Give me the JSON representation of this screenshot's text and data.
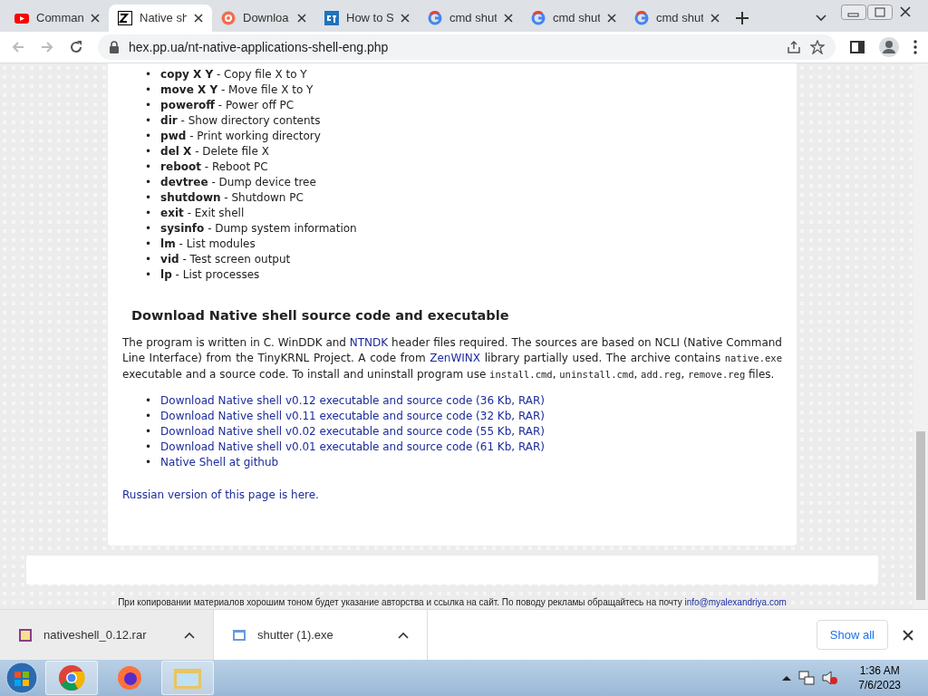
{
  "browser": {
    "tabs": [
      {
        "title": "Comman",
        "selected": false
      },
      {
        "title": "Native sh",
        "selected": true
      },
      {
        "title": "Downloa",
        "selected": false
      },
      {
        "title": "How to S",
        "selected": false
      },
      {
        "title": "cmd shut",
        "selected": false
      },
      {
        "title": "cmd shut",
        "selected": false
      },
      {
        "title": "cmd shut",
        "selected": false
      }
    ],
    "url": "hex.pp.ua/nt-native-applications-shell-eng.php"
  },
  "commands": [
    {
      "bullet": "•",
      "text": "**copy X Y** - Copy file X to Y"
    },
    {
      "bullet": "•",
      "text": "**move X Y** - Move file X to Y"
    },
    {
      "bullet": "•",
      "text": "**poweroff** - Power off PC"
    },
    {
      "bullet": "•",
      "text": "**dir** - Show directory contents"
    },
    {
      "bullet": "•",
      "text": "**pwd** - Print working directory"
    },
    {
      "bullet": "•",
      "text": "**del X** - Delete file X"
    },
    {
      "bullet": "•",
      "text": "**reboot** - Reboot PC"
    },
    {
      "bullet": "•",
      "text": "**devtree** - Dump device tree"
    },
    {
      "bullet": "•",
      "text": "**shutdown** - Shutdown PC"
    },
    {
      "bullet": "•",
      "text": "**exit** - Exit shell"
    },
    {
      "bullet": "•",
      "text": "**sysinfo** - Dump system information"
    },
    {
      "bullet": "•",
      "text": "**lm** - List modules"
    },
    {
      "bullet": "•",
      "text": "**vid** - Test screen output"
    },
    {
      "bullet": "•",
      "text": "**lp** - List processes"
    }
  ],
  "section_title": "Download Native shell source code and executable",
  "paragraph": [
    {
      "kind": "text",
      "text": "The program is written in C. WinDDK and "
    },
    {
      "kind": "link",
      "text": "NTNDK"
    },
    {
      "kind": "text",
      "text": " header files required. The sources are based on NCLI (Native Command Line Interface) from the TinyKRNL Project. A code from "
    },
    {
      "kind": "link",
      "text": "ZenWINX"
    },
    {
      "kind": "text",
      "text": " library partially used. The archive contains "
    },
    {
      "kind": "code",
      "text": "native.exe"
    },
    {
      "kind": "text",
      "text": " executable and a source code. To install and uninstall program use "
    },
    {
      "kind": "code",
      "text": "install.cmd"
    },
    {
      "kind": "text",
      "text": ", "
    },
    {
      "kind": "code",
      "text": "uninstall.cmd"
    },
    {
      "kind": "text",
      "text": ", "
    },
    {
      "kind": "code",
      "text": "add.reg"
    },
    {
      "kind": "text",
      "text": ", "
    },
    {
      "kind": "code",
      "text": "remove.reg"
    },
    {
      "kind": "text",
      "text": " files."
    }
  ],
  "downloads": [
    {
      "bullet": "•",
      "text": "Download Native shell v0.12 executable and source code (36 Kb, RAR)"
    },
    {
      "bullet": "•",
      "text": "Download Native shell v0.11 executable and source code (32 Kb, RAR)"
    },
    {
      "bullet": "•",
      "text": "Download Native shell v0.02 executable and source code (55 Kb, RAR)"
    },
    {
      "bullet": "•",
      "text": "Download Native shell v0.01 executable and source code (61 Kb, RAR)"
    },
    {
      "bullet": "•",
      "text": "Native Shell at github"
    }
  ],
  "russian_link": "Russian version of this page is here.",
  "footer": {
    "text": "При копировании материалов хорошим тоном будет указание авторства и ссылка на сайт. По поводу рекламы обращайтесь на почту ",
    "email": "info@myalexandriya.com"
  },
  "download_bar": {
    "items": [
      {
        "name": "nativeshell_0.12.rar",
        "hovered": true
      },
      {
        "name": "shutter (1).exe",
        "hovered": false
      }
    ],
    "show_all": "Show all"
  },
  "taskbar": {
    "time": "1:36 AM",
    "date": "7/6/2023"
  }
}
